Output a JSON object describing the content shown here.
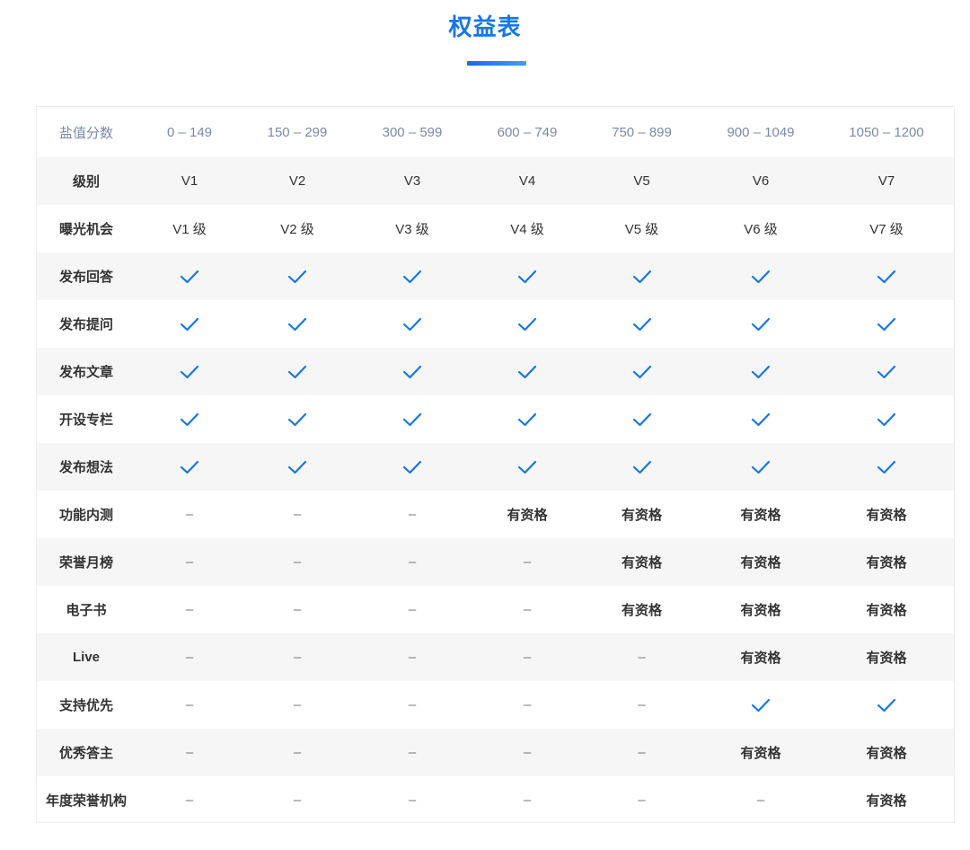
{
  "page": {
    "title": "权益表",
    "accent_color": "#1677e5"
  },
  "table": {
    "header": {
      "label": "盐值分数",
      "columns": [
        "0 – 149",
        "150 – 299",
        "300 – 599",
        "600 – 749",
        "750 – 899",
        "900 – 1049",
        "1050 – 1200"
      ]
    },
    "rows": [
      {
        "label": "级别",
        "cells": [
          "V1",
          "V2",
          "V3",
          "V4",
          "V5",
          "V6",
          "V7"
        ]
      },
      {
        "label": "曝光机会",
        "cells": [
          "V1 级",
          "V2 级",
          "V3 级",
          "V4 级",
          "V5 级",
          "V6 级",
          "V7 级"
        ]
      },
      {
        "label": "发布回答",
        "cells": [
          "check",
          "check",
          "check",
          "check",
          "check",
          "check",
          "check"
        ]
      },
      {
        "label": "发布提问",
        "cells": [
          "check",
          "check",
          "check",
          "check",
          "check",
          "check",
          "check"
        ]
      },
      {
        "label": "发布文章",
        "cells": [
          "check",
          "check",
          "check",
          "check",
          "check",
          "check",
          "check"
        ]
      },
      {
        "label": "开设专栏",
        "cells": [
          "check",
          "check",
          "check",
          "check",
          "check",
          "check",
          "check"
        ]
      },
      {
        "label": "发布想法",
        "cells": [
          "check",
          "check",
          "check",
          "check",
          "check",
          "check",
          "check"
        ]
      },
      {
        "label": "功能内测",
        "cells": [
          "–",
          "–",
          "–",
          "有资格",
          "有资格",
          "有资格",
          "有资格"
        ]
      },
      {
        "label": "荣誉月榜",
        "cells": [
          "–",
          "–",
          "–",
          "–",
          "有资格",
          "有资格",
          "有资格"
        ]
      },
      {
        "label": "电子书",
        "cells": [
          "–",
          "–",
          "–",
          "–",
          "有资格",
          "有资格",
          "有资格"
        ]
      },
      {
        "label": "Live",
        "cells": [
          "–",
          "–",
          "–",
          "–",
          "–",
          "有资格",
          "有资格"
        ]
      },
      {
        "label": "支持优先",
        "cells": [
          "–",
          "–",
          "–",
          "–",
          "–",
          "check",
          "check"
        ]
      },
      {
        "label": "优秀答主",
        "cells": [
          "–",
          "–",
          "–",
          "–",
          "–",
          "有资格",
          "有资格"
        ]
      },
      {
        "label": "年度荣誉机构",
        "cells": [
          "–",
          "–",
          "–",
          "–",
          "–",
          "–",
          "有资格"
        ]
      }
    ]
  }
}
